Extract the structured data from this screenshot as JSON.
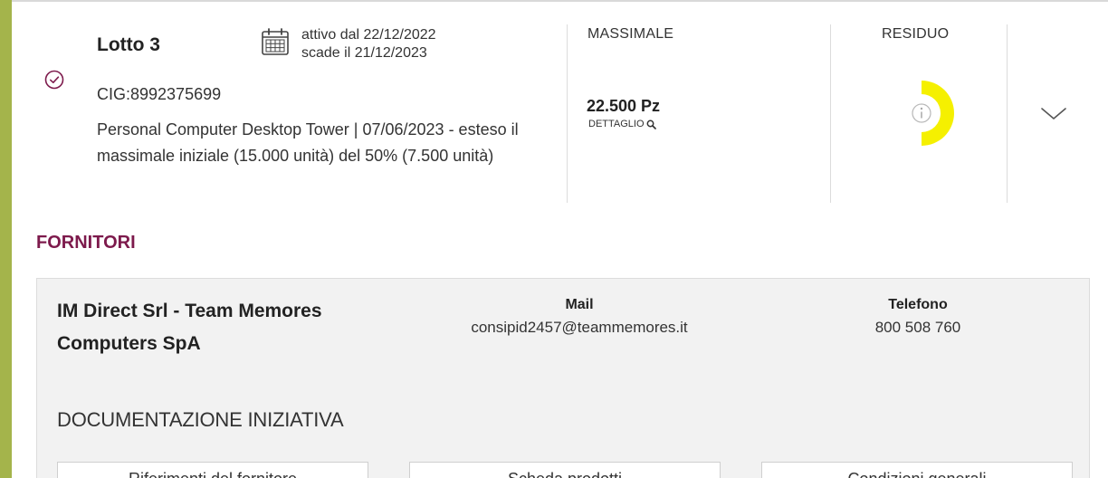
{
  "lotto": {
    "title": "Lotto 3",
    "active_from": "attivo dal 22/12/2022",
    "expires": "scade il 21/12/2023",
    "cig": "CIG:8992375699",
    "description": "Personal Computer Desktop Tower | 07/06/2023 - esteso il massimale iniziale (15.000 unità) del 50% (7.500 unità)",
    "massimale_header": "MASSIMALE",
    "massimale_value": "22.500 Pz",
    "dettaglio_label": "DETTAGLIO",
    "residuo_header": "RESIDUO",
    "residuo_fraction": 0.5
  },
  "colors": {
    "accent": "#a4b44b",
    "section_title": "#7d1a4c",
    "gauge": "#f5f000",
    "status_icon": "#7d1a4c"
  },
  "icons": {
    "status": "check-circle-icon",
    "calendar": "calendar-icon",
    "search": "search-icon",
    "info": "info-icon",
    "expand": "chevron-down-icon"
  },
  "fornitori": {
    "title": "FORNITORI",
    "supplier_name": "IM Direct Srl - Team Memores Computers SpA",
    "mail_label": "Mail",
    "mail_value": "consipid2457@teammemores.it",
    "phone_label": "Telefono",
    "phone_value": "800 508 760",
    "documentation_title": "DOCUMENTAZIONE INIZIATIVA",
    "doc_buttons": [
      "Riferimenti del fornitore",
      "Scheda prodotti",
      "Condizioni generali"
    ]
  }
}
